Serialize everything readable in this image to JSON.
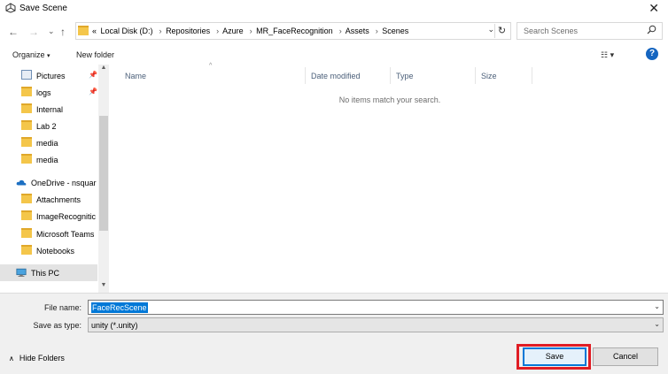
{
  "window": {
    "title": "Save Scene",
    "icon": "unity-icon"
  },
  "nav_buttons": {
    "back": "←",
    "forward": "→",
    "recent": "⌄",
    "up": "↑"
  },
  "address": {
    "overflow": "«",
    "crumbs": [
      "Local Disk (D:)",
      "Repositories",
      "Azure",
      "MR_FaceRecognition",
      "Assets",
      "Scenes"
    ],
    "refresh": "↻",
    "dropdown": "⌄"
  },
  "search": {
    "placeholder": "Search Scenes",
    "icon": "search-icon"
  },
  "toolbar": {
    "organize_label": "Organize",
    "new_folder_label": "New folder",
    "view_label": "☷ ▾",
    "help_label": "?"
  },
  "nav_pane": {
    "items": [
      {
        "label": "Pictures",
        "icon": "pictures-icon",
        "pinned": true
      },
      {
        "label": "logs",
        "icon": "folder-icon",
        "pinned": true
      },
      {
        "label": "Internal",
        "icon": "folder-icon",
        "pinned": false
      },
      {
        "label": "Lab 2",
        "icon": "folder-icon",
        "pinned": false
      },
      {
        "label": "media",
        "icon": "folder-icon",
        "pinned": false
      },
      {
        "label": "media",
        "icon": "folder-icon",
        "pinned": false
      },
      {
        "label": "OneDrive - nsquar",
        "icon": "onedrive-icon",
        "pinned": false
      },
      {
        "label": "Attachments",
        "icon": "folder-icon",
        "pinned": false
      },
      {
        "label": "ImageRecognitic",
        "icon": "folder-icon",
        "pinned": false
      },
      {
        "label": "Microsoft Teams",
        "icon": "folder-icon",
        "pinned": false
      },
      {
        "label": "Notebooks",
        "icon": "folder-icon",
        "pinned": false
      },
      {
        "label": "This PC",
        "icon": "computer-icon",
        "pinned": false,
        "selected": true
      }
    ]
  },
  "columns": {
    "name": "Name",
    "date": "Date modified",
    "type": "Type",
    "size": "Size"
  },
  "content": {
    "empty_message": "No items match your search."
  },
  "form": {
    "file_name_label": "File name:",
    "file_name_value": "FaceRecScene",
    "save_type_label": "Save as type:",
    "save_type_value": "unity (*.unity)"
  },
  "footer": {
    "hide_folders_label": "Hide Folders",
    "save_label": "Save",
    "cancel_label": "Cancel"
  },
  "colors": {
    "accent": "#0078d7",
    "highlight_box": "#e01d24",
    "folder": "#f4c64a"
  }
}
